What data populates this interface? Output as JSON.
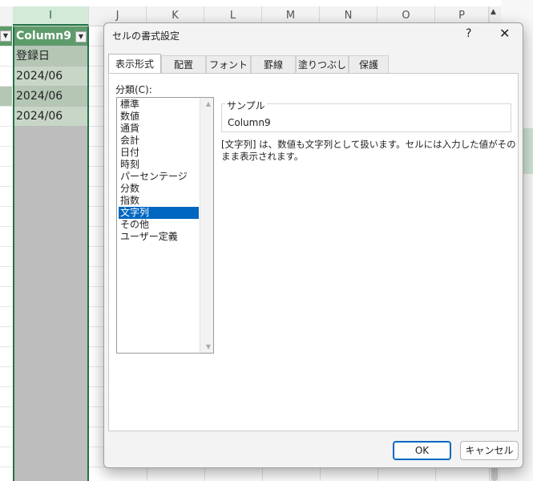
{
  "spreadsheet": {
    "columns": [
      "I",
      "J",
      "K",
      "L",
      "M",
      "N",
      "O",
      "P"
    ],
    "header_cell": "Column9",
    "cells": [
      "登録日",
      "2024/06",
      "2024/06",
      "2024/06"
    ]
  },
  "dialog": {
    "title": "セルの書式設定",
    "help": "?",
    "close": "✕",
    "tabs": [
      "表示形式",
      "配置",
      "フォント",
      "罫線",
      "塗りつぶし",
      "保護"
    ],
    "active_tab": "表示形式",
    "category_label": "分類(C):",
    "categories": [
      "標準",
      "数値",
      "通貨",
      "会計",
      "日付",
      "時刻",
      "パーセンテージ",
      "分数",
      "指数",
      "文字列",
      "その他",
      "ユーザー定義"
    ],
    "selected_category": "文字列",
    "sample_label": "サンプル",
    "sample_value": "Column9",
    "description": "[文字列] は、数値も文字列として扱います。セルには入力した値がそのまま表示されます。",
    "ok_label": "OK",
    "cancel_label": "キャンセル"
  },
  "colors": {
    "accent": "#0067c0",
    "excel_green": "#217346",
    "table_header": "#5e9b6b"
  }
}
